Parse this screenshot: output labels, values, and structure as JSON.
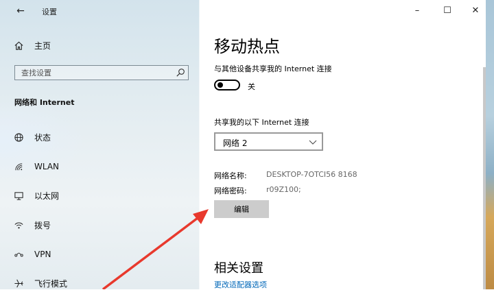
{
  "window": {
    "title": "设置",
    "back": "←",
    "minimize": "–",
    "maximize": "☐",
    "close": "✕"
  },
  "sidebar": {
    "home_label": "主页",
    "search_placeholder": "查找设置",
    "section_title": "网络和 Internet",
    "items": [
      {
        "label": "状态",
        "icon": "globe-icon"
      },
      {
        "label": "WLAN",
        "icon": "wifi-icon"
      },
      {
        "label": "以太网",
        "icon": "ethernet-icon"
      },
      {
        "label": "拨号",
        "icon": "dialup-icon"
      },
      {
        "label": "VPN",
        "icon": "vpn-icon"
      },
      {
        "label": "飞行模式",
        "icon": "airplane-icon"
      }
    ]
  },
  "main": {
    "title": "移动热点",
    "share_desc": "与其他设备共享我的 Internet 连接",
    "toggle_state": "关",
    "share_from_label": "共享我的以下 Internet 连接",
    "share_from_value": "网络 2",
    "network_name_key": "网络名称:",
    "network_name_value": "DESKTOP-7OTCI56 8168",
    "network_password_key": "网络密码:",
    "network_password_value": "r09Z100;",
    "edit_label": "编辑",
    "related_title": "相关设置",
    "adapter_link": "更改适配器选项"
  },
  "colors": {
    "link": "#0067b8",
    "arrow": "#e8392d",
    "button_bg": "#cccccc"
  }
}
